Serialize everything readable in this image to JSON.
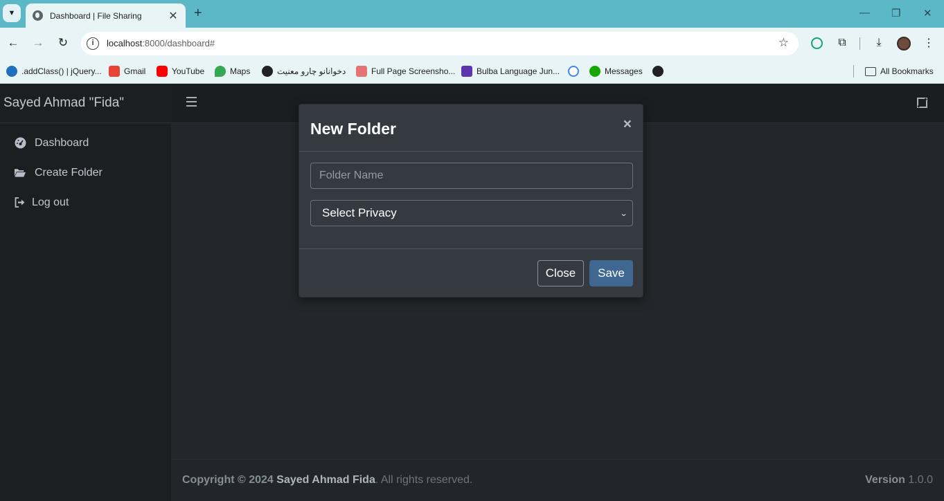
{
  "browser": {
    "tab_title": "Dashboard | File Sharing",
    "url_host": "localhost",
    "url_path": ":8000/dashboard#",
    "bookmarks": [
      ".addClass() | jQuery...",
      "Gmail",
      "YouTube",
      "Maps",
      "دخوانانو چارو معنيت",
      "Full Page Screensho...",
      "Bulba Language Jun...",
      "",
      "Messages",
      ""
    ],
    "all_bookmarks": "All Bookmarks"
  },
  "sidebar": {
    "brand": "Sayed Ahmad \"Fida\"",
    "items": [
      {
        "label": "Dashboard",
        "icon": "dashboard-icon"
      },
      {
        "label": "Create Folder",
        "icon": "folder-open-icon"
      },
      {
        "label": "Log out",
        "icon": "sign-out-icon"
      }
    ]
  },
  "modal": {
    "title": "New Folder",
    "close_symbol": "×",
    "folder_name_placeholder": "Folder Name",
    "privacy_selected": "Select Privacy",
    "close_label": "Close",
    "save_label": "Save"
  },
  "footer": {
    "copyright_prefix": "Copyright © 2024",
    "author": "Sayed Ahmad Fida",
    "rights": ". All rights reserved.",
    "version_label": "Version",
    "version_value": "1.0.0"
  },
  "colors": {
    "tabbar": "#5cb8c7",
    "sidebar": "#1c1f22",
    "modal_bg": "#343a40",
    "save_button": "#3f6791"
  }
}
